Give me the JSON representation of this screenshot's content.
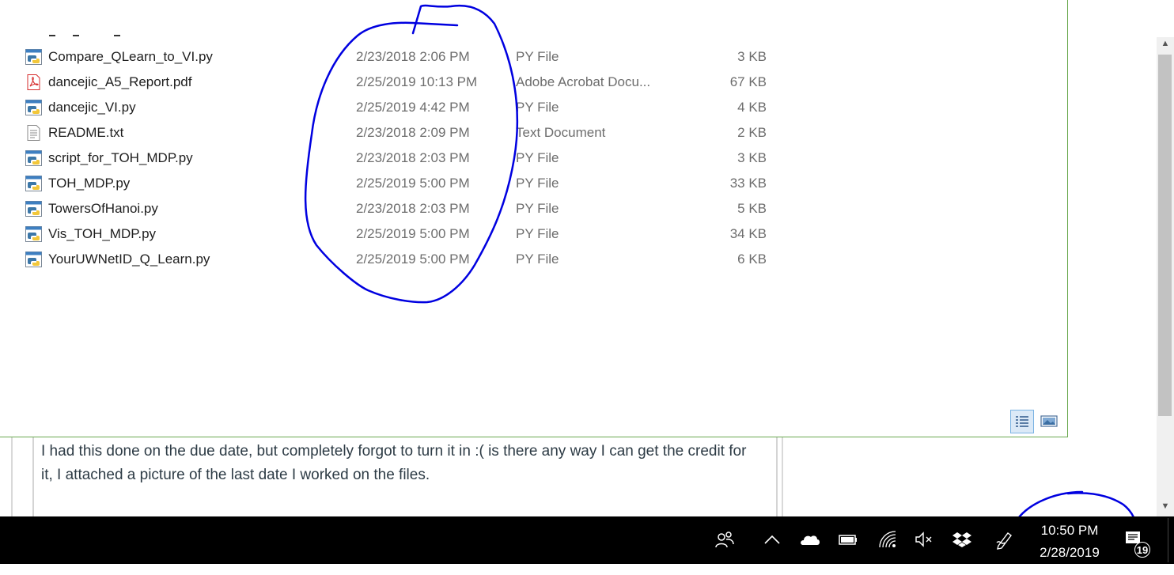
{
  "explorer": {
    "files": [
      {
        "name": "Compare_QLearn_to_VI.py",
        "date": "2/23/2018 2:06 PM",
        "type": "PY File",
        "size": "3 KB",
        "icon": "python-file-icon"
      },
      {
        "name": "dancejic_A5_Report.pdf",
        "date": "2/25/2019 10:13 PM",
        "type": "Adobe Acrobat Docu...",
        "size": "67 KB",
        "icon": "pdf-file-icon"
      },
      {
        "name": "dancejic_VI.py",
        "date": "2/25/2019 4:42 PM",
        "type": "PY File",
        "size": "4 KB",
        "icon": "python-file-icon"
      },
      {
        "name": "README.txt",
        "date": "2/23/2018 2:09 PM",
        "type": "Text Document",
        "size": "2 KB",
        "icon": "text-file-icon"
      },
      {
        "name": "script_for_TOH_MDP.py",
        "date": "2/23/2018 2:03 PM",
        "type": "PY File",
        "size": "3 KB",
        "icon": "python-file-icon"
      },
      {
        "name": "TOH_MDP.py",
        "date": "2/25/2019 5:00 PM",
        "type": "PY File",
        "size": "33 KB",
        "icon": "python-file-icon"
      },
      {
        "name": "TowersOfHanoi.py",
        "date": "2/23/2018 2:03 PM",
        "type": "PY File",
        "size": "5 KB",
        "icon": "python-file-icon"
      },
      {
        "name": "Vis_TOH_MDP.py",
        "date": "2/25/2019 5:00 PM",
        "type": "PY File",
        "size": "34 KB",
        "icon": "python-file-icon"
      },
      {
        "name": "YourUWNetID_Q_Learn.py",
        "date": "2/25/2019 5:00 PM",
        "type": "PY File",
        "size": "6 KB",
        "icon": "python-file-icon"
      }
    ]
  },
  "comment": {
    "text": "I had this done on the due date, but completely forgot to turn it in :( is there any way I can get the credit for it, I attached a picture of the last date I worked on the files."
  },
  "taskbar": {
    "time": "10:50 PM",
    "date": "2/28/2019",
    "notification_count": "19",
    "icons": [
      "people-icon",
      "chevron-up-icon",
      "onedrive-icon",
      "battery-icon",
      "wifi-icon",
      "volume-muted-icon",
      "dropbox-icon",
      "pen-icon",
      "action-center-icon"
    ]
  },
  "colors": {
    "annotation_ink": "#0000e0",
    "taskbar_bg": "#000000",
    "window_border": "#6aa84f"
  }
}
